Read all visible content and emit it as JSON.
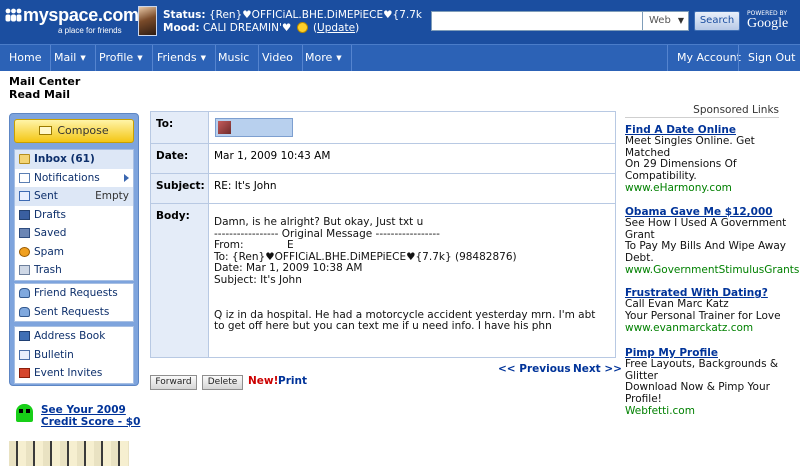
{
  "header": {
    "logo_text": "myspace.com",
    "logo_tagline": "a place for friends",
    "status_label": "Status:",
    "status_value": "{Ren}♥OFFICiAL.BHE.DiMEPiECE♥{7.7k",
    "mood_label": "Mood:",
    "mood_value": "CALI DREAMIN'♥",
    "update_label": "Update",
    "update_open": "(",
    "update_close": ")",
    "search_scope": "Web",
    "search_button": "Search",
    "powered_by": "POWERED BY",
    "google": "Google"
  },
  "nav": {
    "home": "Home",
    "mail": "Mail",
    "profile": "Profile",
    "friends": "Friends",
    "music": "Music",
    "video": "Video",
    "more": "More",
    "my_account": "My Account",
    "sign_out": "Sign Out"
  },
  "page": {
    "title": "Mail Center",
    "subtitle": "Read Mail"
  },
  "sidebar": {
    "compose": "Compose",
    "inbox": "Inbox (61)",
    "notifications": "Notifications",
    "sent": "Sent",
    "sent_action": "Empty",
    "drafts": "Drafts",
    "saved": "Saved",
    "spam": "Spam",
    "trash": "Trash",
    "friend_requests": "Friend Requests",
    "sent_requests": "Sent Requests",
    "address_book": "Address Book",
    "bulletin": "Bulletin",
    "event_invites": "Event Invites"
  },
  "promo": {
    "line1": "See Your 2009",
    "line2": "Credit Score - $0"
  },
  "message": {
    "to_label": "To:",
    "date_label": "Date:",
    "date_value": "Mar 1, 2009 10:43 AM",
    "subject_label": "Subject:",
    "subject_value": "RE: It's John",
    "body_label": "Body:",
    "body_text": "Damn, is he alright? But okay, Just txt u\n----------------- Original Message -----------------\nFrom:             E\nTo: {Ren}♥OFFICiAL.BHE.DiMEPiECE♥{7.7k} (98482876)\nDate: Mar 1, 2009 10:38 AM\nSubject: It's John\n\n\nQ iz in da hospital. He had a motorcycle accident yesterday mrn. I'm abt\nto get off here but you can text me if u need info. I have his phn"
  },
  "actions": {
    "forward": "Forward",
    "delete": "Delete",
    "new": "New!",
    "print": "Print",
    "previous": "<< Previous",
    "next": "Next >>"
  },
  "sponsored": {
    "heading": "Sponsored Links",
    "ads": [
      {
        "title": "Find A Date Online",
        "lines": [
          "Meet Singles Online. Get",
          "Matched",
          "On 29 Dimensions Of",
          "Compatibility."
        ],
        "url": "www.eHarmony.com"
      },
      {
        "title": "Obama Gave Me $12,000",
        "lines": [
          "See How I Used A Government",
          "Grant",
          "To Pay My Bills And Wipe Away",
          "Debt."
        ],
        "url": "www.GovernmentStimulusGrants"
      },
      {
        "title": "Frustrated With Dating?",
        "lines": [
          "Call Evan Marc Katz",
          "Your Personal Trainer for Love"
        ],
        "url": "www.evanmarckatz.com"
      },
      {
        "title": "Pimp My Profile",
        "lines": [
          "Free Layouts, Backgrounds &",
          "Glitter",
          "Download Now & Pimp Your",
          "Profile!"
        ],
        "url": "Webfetti.com"
      }
    ]
  }
}
